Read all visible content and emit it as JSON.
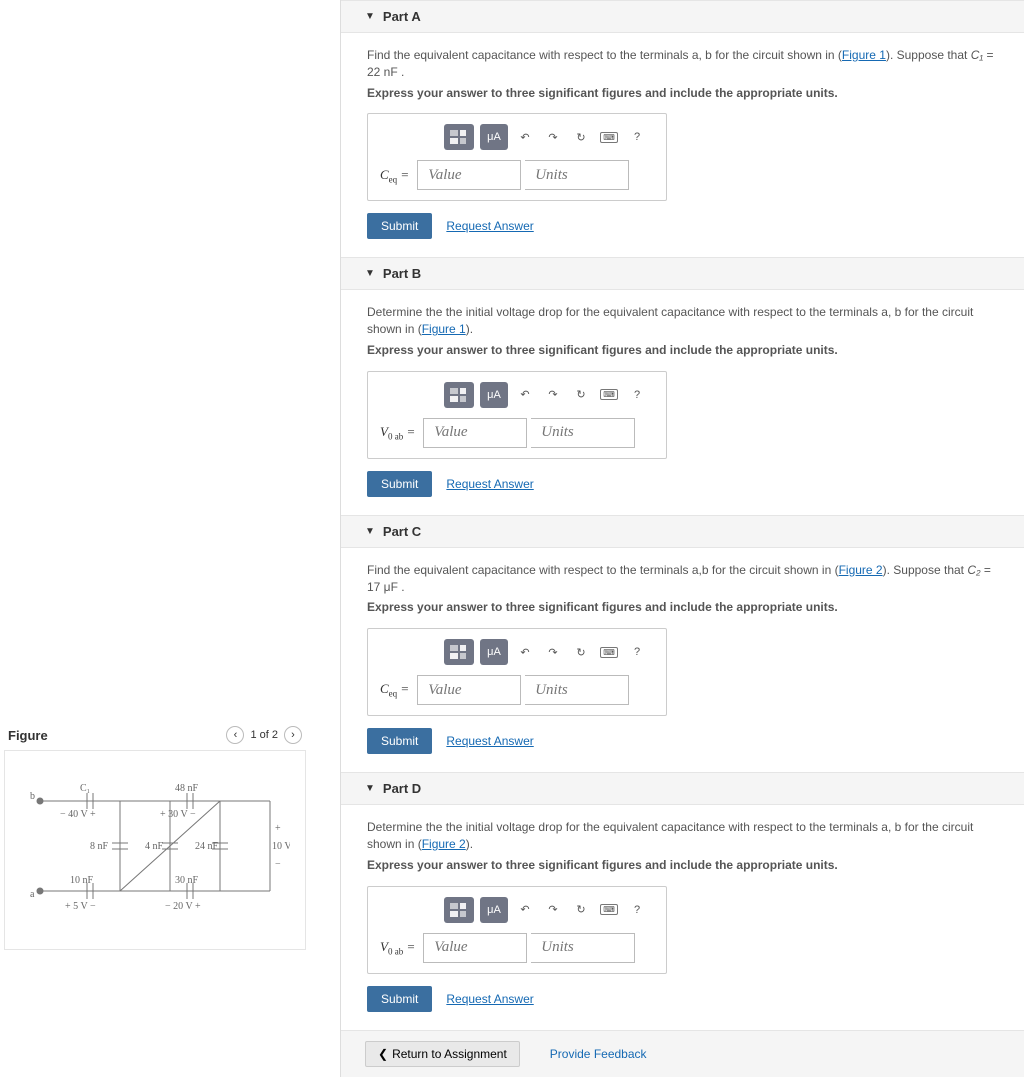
{
  "parts": {
    "A": {
      "title": "Part A",
      "prompt_pre": "Find the equivalent capacitance with respect to the terminals a, b for the circuit shown in (",
      "figure_link": "Figure 1",
      "prompt_post": "). Suppose that ",
      "var": "C₁",
      "eq": " = 22  nF .",
      "express": "Express your answer to three significant figures and include the appropriate units.",
      "label_html": "C",
      "label_sub": "eq",
      "value_ph": "Value",
      "units_ph": "Units",
      "submit": "Submit",
      "request": "Request Answer"
    },
    "B": {
      "title": "Part B",
      "prompt_pre": "Determine the the initial voltage drop for the equivalent capacitance with respect to the terminals a, b for the circuit shown in (",
      "figure_link": "Figure 1",
      "prompt_post": ").",
      "express": "Express your answer to three significant figures and include the appropriate units.",
      "label_html": "V",
      "label_sub": "0 ab",
      "value_ph": "Value",
      "units_ph": "Units",
      "submit": "Submit",
      "request": "Request Answer"
    },
    "C": {
      "title": "Part C",
      "prompt_pre": "Find the equivalent capacitance with respect to the terminals a,b for the circuit shown in (",
      "figure_link": "Figure 2",
      "prompt_post": "). Suppose that ",
      "var": "C₂",
      "eq": " = 17  μF .",
      "express": "Express your answer to three significant figures and include the appropriate units.",
      "label_html": "C",
      "label_sub": "eq",
      "value_ph": "Value",
      "units_ph": "Units",
      "submit": "Submit",
      "request": "Request Answer"
    },
    "D": {
      "title": "Part D",
      "prompt_pre": "Determine the the initial voltage drop for the equivalent capacitance with respect to the terminals a, b for the circuit shown in (",
      "figure_link": "Figure 2",
      "prompt_post": ").",
      "express": "Express your answer to three significant figures and include the appropriate units.",
      "label_html": "V",
      "label_sub": "0 ab",
      "value_ph": "Value",
      "units_ph": "Units",
      "submit": "Submit",
      "request": "Request Answer"
    }
  },
  "toolbar": {
    "mu": "μA",
    "help": "?"
  },
  "footer": {
    "return": "Return to Assignment",
    "feedback": "Provide Feedback"
  },
  "figure": {
    "title": "Figure",
    "pager": "1 of 2",
    "labels": {
      "c1": "C₁",
      "c48": "48 nF",
      "v40": "− 40 V +",
      "v30": "+ 30 V −",
      "c8": "8 nF",
      "c4": "4 nF",
      "c24": "24 nF",
      "v10p": "+",
      "v10": "10 V",
      "v10m": "−",
      "c10": "10 nF",
      "c30": "30 nF",
      "v5": "+ 5 V −",
      "v20": "− 20 V +",
      "ta": "a",
      "tb": "b"
    }
  }
}
